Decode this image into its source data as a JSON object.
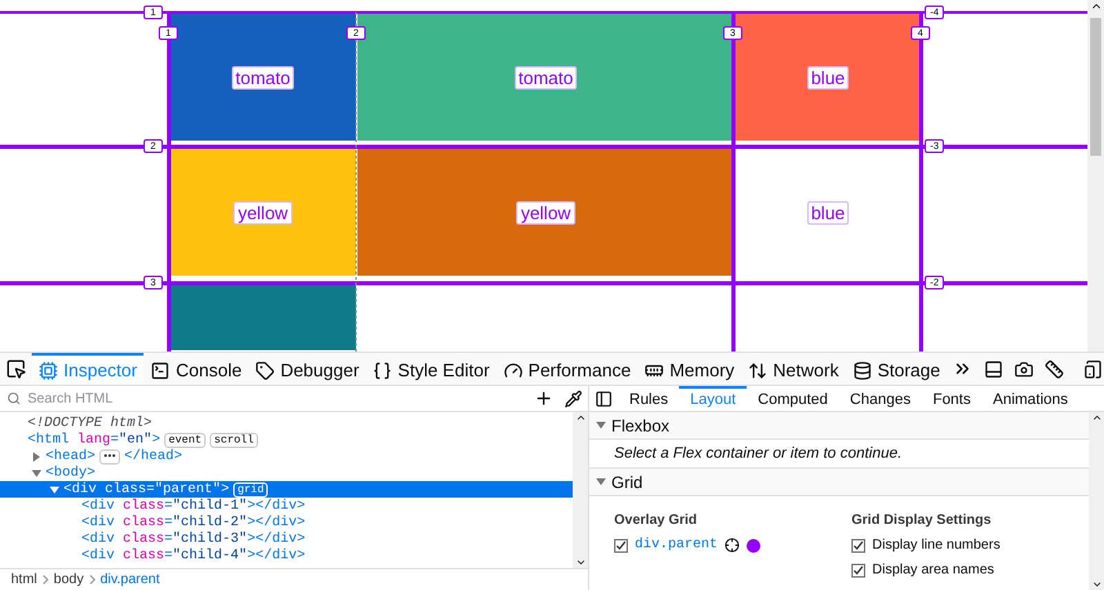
{
  "viewport": {
    "cells": [
      {
        "area": "tomato",
        "color": "#1560bd"
      },
      {
        "area": "tomato",
        "color": "#3eb489"
      },
      {
        "area": "blue",
        "color": "#ff6347"
      },
      {
        "area": "yellow",
        "color": "#fec10d"
      },
      {
        "area": "yellow",
        "color": "#d9690f"
      },
      {
        "area": "blue",
        "color": "#ffffff"
      },
      {
        "color": "#0f7b8a"
      }
    ],
    "column_lines": [
      "1",
      "2",
      "3",
      "4"
    ],
    "row_lines": [
      "1",
      "2",
      "3"
    ],
    "row_lines_negative": [
      "-4",
      "-3",
      "-2"
    ]
  },
  "toolbar": {
    "tabs": [
      {
        "label": "Inspector",
        "selected": true
      },
      {
        "label": "Console",
        "selected": false
      },
      {
        "label": "Debugger",
        "selected": false
      },
      {
        "label": "Style Editor",
        "selected": false
      },
      {
        "label": "Performance",
        "selected": false
      },
      {
        "label": "Memory",
        "selected": false
      },
      {
        "label": "Network",
        "selected": false
      },
      {
        "label": "Storage",
        "selected": false
      }
    ]
  },
  "inspector": {
    "search": {
      "placeholder": "Search HTML"
    },
    "tree": [
      {
        "kind": "doctype",
        "markup": "<!DOCTYPE html>",
        "selected": false
      },
      {
        "kind": "element",
        "markup": "<html lang=\"en\">",
        "badges": [
          "event",
          "scroll"
        ],
        "selected": false,
        "children": [
          {
            "kind": "element",
            "markup": "<head>",
            "closing": "</head>",
            "expanded": false,
            "selected": false
          },
          {
            "kind": "element",
            "markup": "<body>",
            "expanded": true,
            "selected": false,
            "children": [
              {
                "kind": "element",
                "markup": "<div class=\"parent\">",
                "badges": [
                  "grid"
                ],
                "expanded": true,
                "selected": true,
                "children": [
                  {
                    "kind": "element",
                    "markup": "<div class=\"child-1\"></div>",
                    "selected": false
                  },
                  {
                    "kind": "element",
                    "markup": "<div class=\"child-2\"></div>",
                    "selected": false
                  },
                  {
                    "kind": "element",
                    "markup": "<div class=\"child-3\"></div>",
                    "selected": false
                  },
                  {
                    "kind": "element",
                    "markup": "<div class=\"child-4\"></div>",
                    "selected": false
                  }
                ]
              }
            ]
          }
        ]
      }
    ],
    "breadcrumbs": [
      {
        "label": "html",
        "selected": false
      },
      {
        "label": "body",
        "selected": false
      },
      {
        "label": "div.parent",
        "selected": true
      }
    ]
  },
  "sidebar": {
    "tabs": [
      {
        "label": "Rules",
        "selected": false
      },
      {
        "label": "Layout",
        "selected": true
      },
      {
        "label": "Computed",
        "selected": false
      },
      {
        "label": "Changes",
        "selected": false
      },
      {
        "label": "Fonts",
        "selected": false
      },
      {
        "label": "Animations",
        "selected": false
      }
    ],
    "flexbox": {
      "title": "Flexbox",
      "expanded": true,
      "message": "Select a Flex container or item to continue."
    },
    "grid": {
      "title": "Grid",
      "expanded": true,
      "overlay": {
        "heading": "Overlay Grid",
        "items": [
          {
            "label": "div.parent",
            "checked": true,
            "color": "#9400ff"
          }
        ]
      },
      "settings": {
        "heading": "Grid Display Settings",
        "items": [
          {
            "label": "Display line numbers",
            "checked": true
          },
          {
            "label": "Display area names",
            "checked": true
          }
        ]
      }
    }
  }
}
